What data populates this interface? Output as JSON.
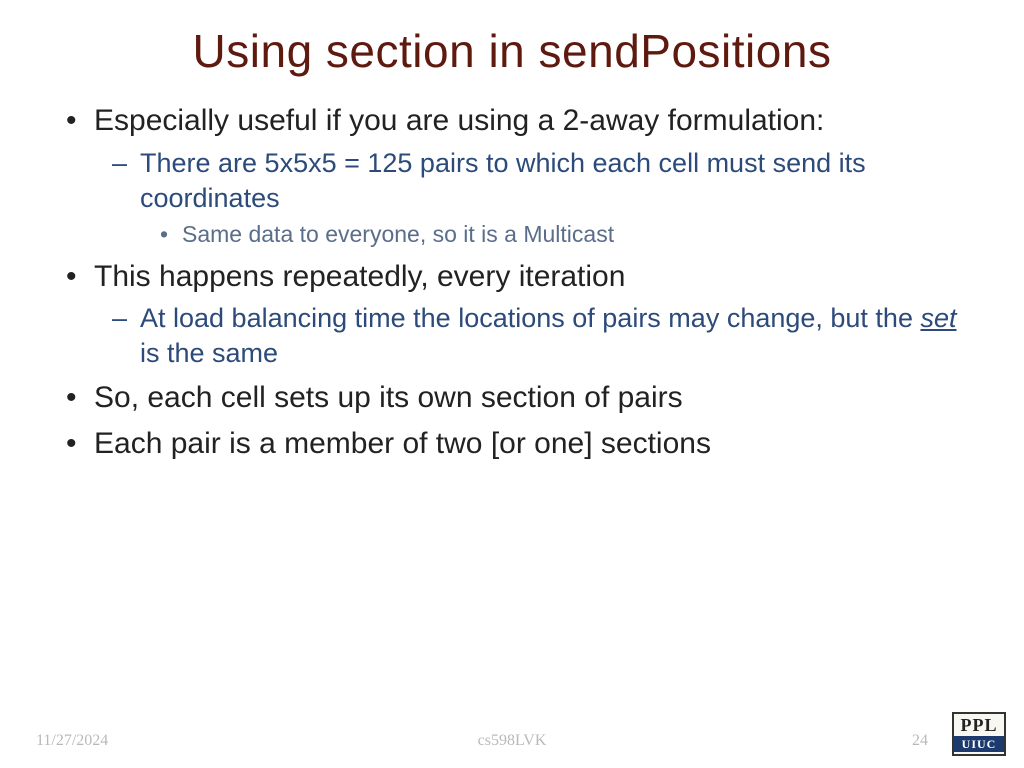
{
  "title": "Using section in sendPositions",
  "bullets": {
    "b1": "Especially useful if you are using a 2-away formulation:",
    "b1_1": "There are 5x5x5 = 125 pairs to which each cell must send its coordinates",
    "b1_1_1": "Same data to everyone, so it is a Multicast",
    "b2": "This happens repeatedly, every iteration",
    "b2_1_pre": "At load balancing time the locations of pairs may change, but the ",
    "b2_1_set": "set",
    "b2_1_post": " is the same",
    "b3": "So, each cell sets up its own section of pairs",
    "b4": "Each pair is a member of two [or one] sections"
  },
  "footer": {
    "date": "11/27/2024",
    "course": "cs598LVK",
    "page": "24"
  },
  "logo": {
    "top": "PPL",
    "bot": "UIUC"
  }
}
